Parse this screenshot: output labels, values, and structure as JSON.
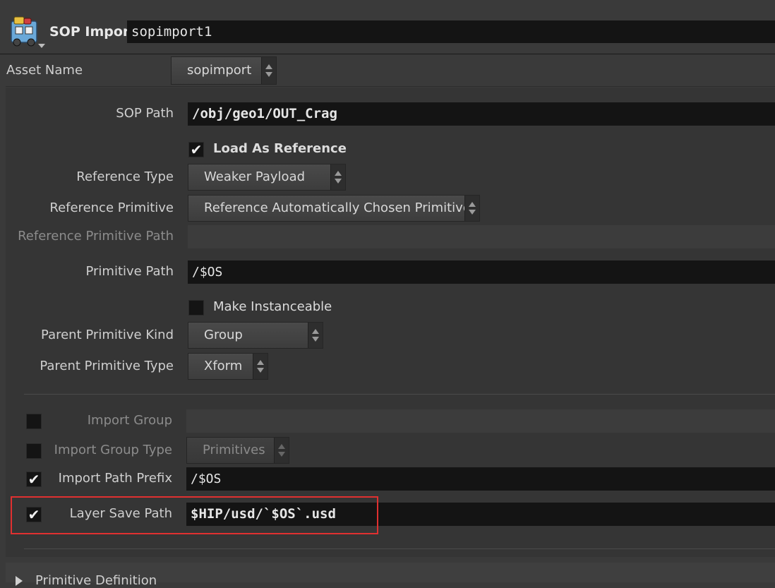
{
  "node": {
    "type_label": "SOP Import",
    "name": "sopimport1",
    "icon": "sop-import-node-icon"
  },
  "asset": {
    "label": "Asset Name",
    "value": "sopimport"
  },
  "params": {
    "sop_path": {
      "label": "SOP Path",
      "value": "/obj/geo1/OUT_Crag"
    },
    "load_as_reference": {
      "label": "Load As Reference",
      "checked": true
    },
    "reference_type": {
      "label": "Reference Type",
      "value": "Weaker Payload"
    },
    "reference_primitive": {
      "label": "Reference Primitive",
      "value": "Reference Automatically Chosen Primitive"
    },
    "reference_primitive_path": {
      "label": "Reference Primitive Path",
      "value": ""
    },
    "primitive_path": {
      "label": "Primitive Path",
      "value": "/$OS"
    },
    "make_instanceable": {
      "label": "Make Instanceable",
      "checked": false
    },
    "parent_primitive_kind": {
      "label": "Parent Primitive Kind",
      "value": "Group"
    },
    "parent_primitive_type": {
      "label": "Parent Primitive Type",
      "value": "Xform"
    },
    "import_group": {
      "label": "Import Group",
      "enabled": false,
      "value": ""
    },
    "import_group_type": {
      "label": "Import Group Type",
      "enabled": false,
      "value": "Primitives"
    },
    "import_path_prefix": {
      "label": "Import Path Prefix",
      "enabled": true,
      "value": "/$OS"
    },
    "layer_save_path": {
      "label": "Layer Save Path",
      "enabled": true,
      "value": "$HIP/usd/`$OS`.usd"
    }
  },
  "folder": {
    "label": "Primitive Definition",
    "collapsed": true
  },
  "colors": {
    "highlight": "#e03030",
    "background": "#3a3a3a",
    "field": "#141414"
  }
}
